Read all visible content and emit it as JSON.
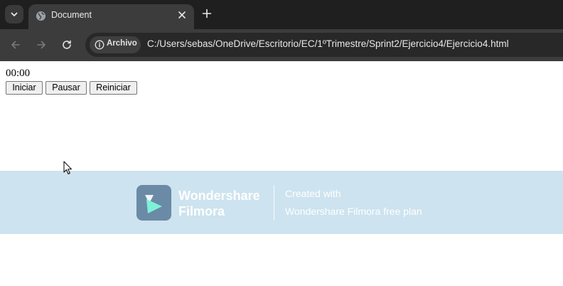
{
  "browser": {
    "tab": {
      "title": "Document"
    },
    "address_bar": {
      "site_info_label": "Archivo",
      "url": "C:/Users/sebas/OneDrive/Escritorio/EC/1ºTrimestre/Sprint2/Ejercicio4/Ejercicio4.html"
    },
    "icons": {
      "tab_search": "chevron-down-icon",
      "favicon": "globe-icon",
      "close_tab": "close-icon",
      "new_tab": "plus-icon",
      "back": "arrow-left-icon",
      "forward": "arrow-right-icon",
      "reload": "reload-icon",
      "site_info": "info-icon"
    }
  },
  "page": {
    "timer": "00:00",
    "buttons": {
      "start": "Iniciar",
      "pause": "Pausar",
      "reset": "Reiniciar"
    }
  },
  "watermark": {
    "brand_line1": "Wondershare",
    "brand_line2": "Filmora",
    "created_with": "Created with",
    "plan": "Wondershare Filmora free plan",
    "colors": {
      "banner": "#cde3ef",
      "logo_tile": "#6a8aa6",
      "logo_mark": "#7ef0d8"
    }
  },
  "colors": {
    "tabstrip": "#1f1f1f",
    "toolbar": "#3c3c3c",
    "omnibox": "#282828",
    "page_background": "#ffffff"
  }
}
